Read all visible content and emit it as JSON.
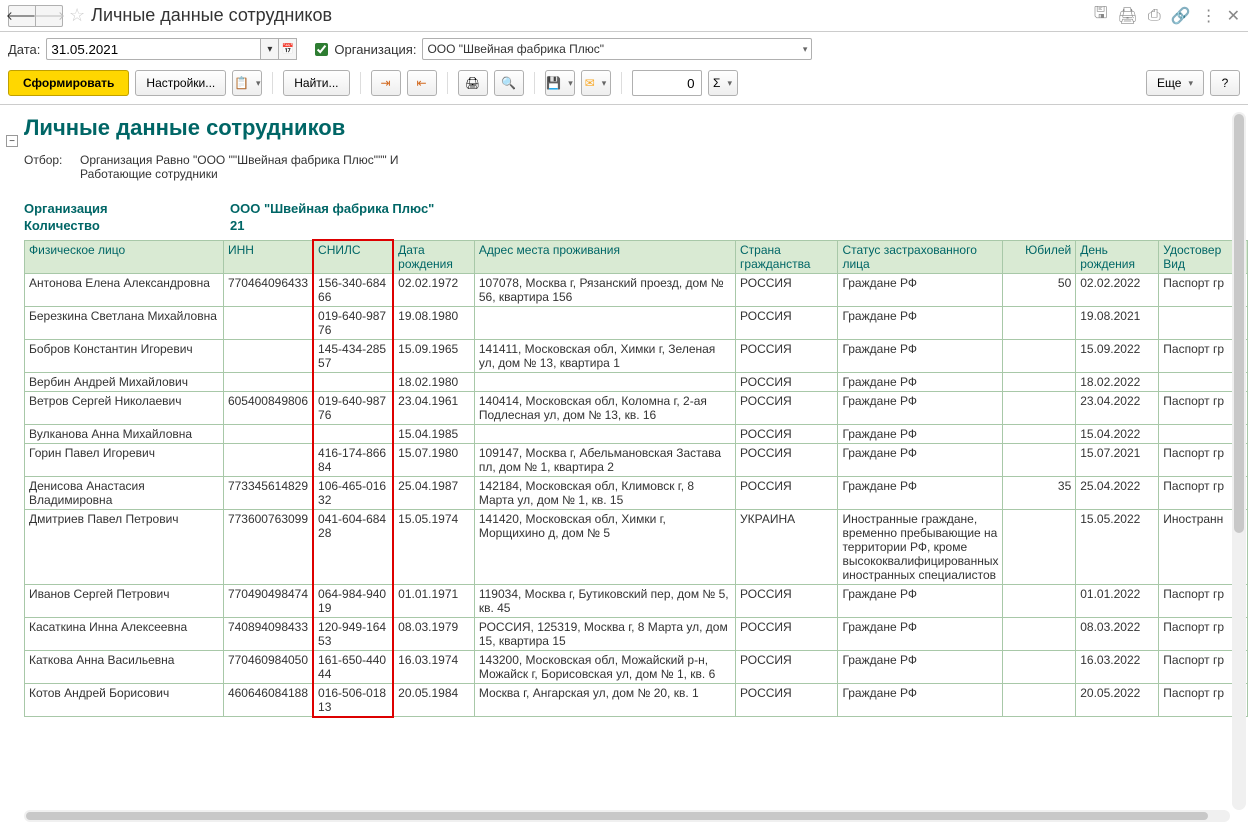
{
  "title": "Личные данные сотрудников",
  "filters": {
    "dateLabel": "Дата:",
    "dateValue": "31.05.2021",
    "orgLabel": "Организация:",
    "orgValue": "ООО \"Швейная фабрика Плюс\""
  },
  "toolbar": {
    "generate": "Сформировать",
    "settings": "Настройки...",
    "find": "Найти...",
    "numValue": "0",
    "more": "Еще",
    "help": "?"
  },
  "report": {
    "title": "Личные данные сотрудников",
    "filterLabel": "Отбор:",
    "filterText1": "Организация Равно \"ООО \"\"Швейная фабрика Плюс\"\"\" И",
    "filterText2": "Работающие сотрудники",
    "orgLabel": "Организация",
    "orgValue": "ООО \"Швейная фабрика Плюс\"",
    "countLabel": "Количество",
    "countValue": "21"
  },
  "columns": [
    "Физическое лицо",
    "ИНН",
    "СНИЛС",
    "Дата рождения",
    "Адрес места проживания",
    "Страна гражданства",
    "Статус застрахованного лица",
    "Юбилей",
    "День рождения",
    "Удостовер Вид"
  ],
  "rows": [
    {
      "name": "Антонова Елена Александровна",
      "inn": "770464096433",
      "snils": "156-340-684 66",
      "bd": "02.02.1972",
      "addr": "107078, Москва г, Рязанский проезд, дом № 56, квартира 156",
      "ctry": "РОССИЯ",
      "stat": "Граждане РФ",
      "jub": "50",
      "daybd": "02.02.2022",
      "doc": "Паспорт гр"
    },
    {
      "name": "Березкина Светлана Михайловна",
      "inn": "",
      "snils": "019-640-987 76",
      "bd": "19.08.1980",
      "addr": "",
      "ctry": "РОССИЯ",
      "stat": "Граждане РФ",
      "jub": "",
      "daybd": "19.08.2021",
      "doc": ""
    },
    {
      "name": "Бобров Константин Игоревич",
      "inn": "",
      "snils": "145-434-285 57",
      "bd": "15.09.1965",
      "addr": "141411, Московская обл, Химки г, Зеленая ул, дом № 13, квартира 1",
      "ctry": "РОССИЯ",
      "stat": "Граждане РФ",
      "jub": "",
      "daybd": "15.09.2022",
      "doc": "Паспорт гр"
    },
    {
      "name": "Вербин Андрей Михайлович",
      "inn": "",
      "snils": "",
      "bd": "18.02.1980",
      "addr": "",
      "ctry": "РОССИЯ",
      "stat": "Граждане РФ",
      "jub": "",
      "daybd": "18.02.2022",
      "doc": ""
    },
    {
      "name": "Ветров Сергей Николаевич",
      "inn": "605400849806",
      "snils": "019-640-987 76",
      "bd": "23.04.1961",
      "addr": "140414, Московская обл, Коломна г, 2-ая Подлесная ул, дом № 13, кв. 16",
      "ctry": "РОССИЯ",
      "stat": "Граждане РФ",
      "jub": "",
      "daybd": "23.04.2022",
      "doc": "Паспорт гр"
    },
    {
      "name": "Вулканова Анна Михайловна",
      "inn": "",
      "snils": "",
      "bd": "15.04.1985",
      "addr": "",
      "ctry": "РОССИЯ",
      "stat": "Граждане РФ",
      "jub": "",
      "daybd": "15.04.2022",
      "doc": ""
    },
    {
      "name": "Горин Павел Игоревич",
      "inn": "",
      "snils": "416-174-866 84",
      "bd": "15.07.1980",
      "addr": "109147, Москва г, Абельмановская Застава пл, дом № 1, квартира 2",
      "ctry": "РОССИЯ",
      "stat": "Граждане РФ",
      "jub": "",
      "daybd": "15.07.2021",
      "doc": "Паспорт гр"
    },
    {
      "name": "Денисова Анастасия Владимировна",
      "inn": "773345614829",
      "snils": "106-465-016 32",
      "bd": "25.04.1987",
      "addr": "142184, Московская обл, Климовск г, 8 Марта ул, дом № 1, кв. 15",
      "ctry": "РОССИЯ",
      "stat": "Граждане РФ",
      "jub": "35",
      "daybd": "25.04.2022",
      "doc": "Паспорт гр"
    },
    {
      "name": "Дмитриев Павел Петрович",
      "inn": "773600763099",
      "snils": "041-604-684 28",
      "bd": "15.05.1974",
      "addr": "141420, Московская обл, Химки г, Морщихино д, дом № 5",
      "ctry": "УКРАИНА",
      "stat": "Иностранные граждане, временно пребывающие на территории РФ, кроме высококвалифицированных иностранных специалистов",
      "jub": "",
      "daybd": "15.05.2022",
      "doc": "Иностранн"
    },
    {
      "name": "Иванов Сергей Петрович",
      "inn": "770490498474",
      "snils": "064-984-940 19",
      "bd": "01.01.1971",
      "addr": "119034, Москва г, Бутиковский пер, дом № 5, кв. 45",
      "ctry": "РОССИЯ",
      "stat": "Граждане РФ",
      "jub": "",
      "daybd": "01.01.2022",
      "doc": "Паспорт гр"
    },
    {
      "name": "Касаткина Инна Алексеевна",
      "inn": "740894098433",
      "snils": "120-949-164 53",
      "bd": "08.03.1979",
      "addr": "РОССИЯ, 125319, Москва г, 8 Марта ул, дом 15, квартира 15",
      "ctry": "РОССИЯ",
      "stat": "Граждане РФ",
      "jub": "",
      "daybd": "08.03.2022",
      "doc": "Паспорт гр"
    },
    {
      "name": "Каткова Анна Васильевна",
      "inn": "770460984050",
      "snils": "161-650-440 44",
      "bd": "16.03.1974",
      "addr": "143200, Московская обл, Можайский р-н, Можайск г, Борисовская ул, дом № 1, кв. 6",
      "ctry": "РОССИЯ",
      "stat": "Граждане РФ",
      "jub": "",
      "daybd": "16.03.2022",
      "doc": "Паспорт гр"
    },
    {
      "name": "Котов Андрей Борисович",
      "inn": "460646084188",
      "snils": "016-506-018 13",
      "bd": "20.05.1984",
      "addr": "Москва г, Ангарская ул, дом № 20, кв. 1",
      "ctry": "РОССИЯ",
      "stat": "Граждане РФ",
      "jub": "",
      "daybd": "20.05.2022",
      "doc": "Паспорт гр"
    }
  ]
}
